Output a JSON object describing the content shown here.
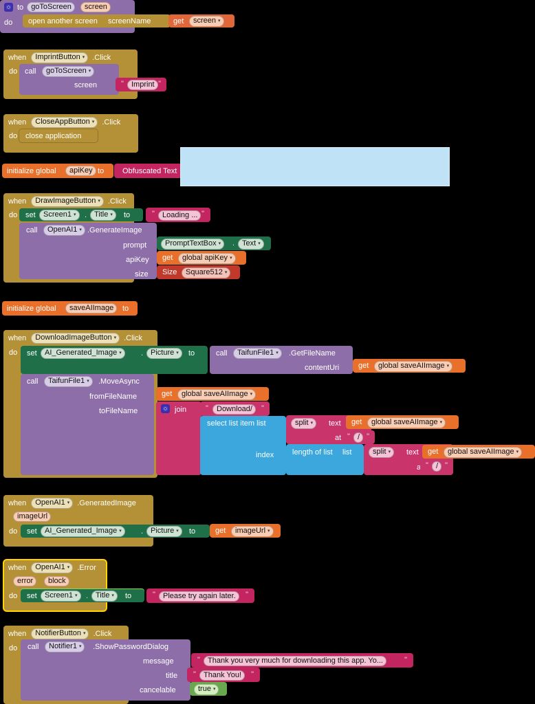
{
  "app": {
    "editor": "MIT App Inventor Blocks Editor",
    "background": "#000000"
  },
  "icons": {
    "gear": "gear-icon",
    "caret": "▾",
    "quote": "\""
  },
  "blocks": {
    "procedure_gotoscreen": {
      "keyword_to": "to",
      "name": "goToScreen",
      "param": "screen",
      "do_label": "do",
      "statement": "open another screen",
      "arg_label": "screenName",
      "get_label": "get",
      "get_value": "screen"
    },
    "imprint_click": {
      "when_label": "when",
      "component": "ImprintButton",
      "event": ".Click",
      "do_label": "do",
      "call_label": "call",
      "procedure": "goToScreen",
      "arg_label": "screen",
      "text_value": "Imprint"
    },
    "closeapp_click": {
      "when_label": "when",
      "component": "CloseAppButton",
      "event": ".Click",
      "do_label": "do",
      "statement": "close application"
    },
    "global_apikey": {
      "init_label": "initialize global",
      "name": "apiKey",
      "to_label": "to",
      "value": "Obfuscated Text"
    },
    "highlight_box": {
      "text": "",
      "color": "#bfe2f6"
    },
    "drawimage_click": {
      "when_label": "when",
      "component": "DrawImageButton",
      "event": ".Click",
      "do_label": "do",
      "set_label": "set",
      "set_component": "Screen1",
      "set_property": "Title",
      "to_label": "to",
      "title_text": "Loading ...",
      "call_label": "call",
      "call_component": "OpenAI1",
      "call_method": ".GenerateImage",
      "arg_prompt_label": "prompt",
      "prompt_component": "PromptTextBox",
      "prompt_property": "Text",
      "arg_apikey_label": "apiKey",
      "get_label": "get",
      "apikey_value": "global apiKey",
      "arg_size_label": "size",
      "size_prefix": "Size",
      "size_value": "Square512"
    },
    "global_saveaiimage": {
      "init_label": "initialize global",
      "name": "saveAIImage",
      "to_label": "to"
    },
    "downloadimage_click": {
      "when_label": "when",
      "component": "DownloadImageButton",
      "event": ".Click",
      "do_label": "do",
      "set_label": "set",
      "set_component": "AI_Generated_Image",
      "set_property": "Picture",
      "to_label": "to",
      "call1_label": "call",
      "call1_component": "TaifunFile1",
      "call1_method": ".GetFileName",
      "contenturi_label": "contentUri",
      "get_label": "get",
      "contenturi_value": "global saveAIImage",
      "call2_label": "call",
      "call2_component": "TaifunFile1",
      "call2_method": ".MoveAsync",
      "from_label": "fromFileName",
      "from_value": "global saveAIImage",
      "to_file_label": "toFileName",
      "join_label": "join",
      "join_text": "Download/",
      "select_label": "select list item  list",
      "split_label": "split",
      "text_label": "text",
      "split_text_value": "global saveAIImage",
      "at_label": "at",
      "at_value": "/",
      "index_label": "index",
      "length_label": "length of list",
      "list_label": "list",
      "split2_label": "split",
      "text2_label": "text",
      "split2_text_value": "global saveAIImage",
      "at2_label": "at",
      "at2_value": "/"
    },
    "openai_generatedimage": {
      "when_label": "when",
      "component": "OpenAI1",
      "event": ".GeneratedImage",
      "param": "imageUrl",
      "do_label": "do",
      "set_label": "set",
      "set_component": "AI_Generated_Image",
      "set_property": "Picture",
      "to_label": "to",
      "get_label": "get",
      "get_value": "imageUrl"
    },
    "openai_error": {
      "when_label": "when",
      "component": "OpenAI1",
      "event": ".Error",
      "param1": "error",
      "param2": "block",
      "do_label": "do",
      "set_label": "set",
      "set_component": "Screen1",
      "set_property": "Title",
      "to_label": "to",
      "title_text": "Please try again later.",
      "selected": true
    },
    "notifier_click": {
      "when_label": "when",
      "component": "NotifierButton",
      "event": ".Click",
      "do_label": "do",
      "call_label": "call",
      "call_component": "Notifier1",
      "call_method": ".ShowPasswordDialog",
      "message_label": "message",
      "message_value": "Thank you very much for downloading this app. Yo...",
      "title_label": "title",
      "title_value": "Thank You!",
      "cancelable_label": "cancelable",
      "cancelable_value": "true"
    }
  }
}
